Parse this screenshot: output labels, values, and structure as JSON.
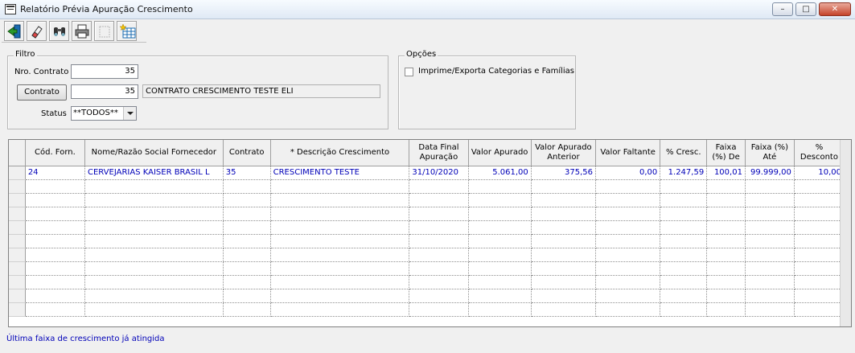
{
  "window": {
    "title": "Relatório Prévia Apuração Crescimento",
    "min_label": "–",
    "max_label": "□",
    "close_label": "✕"
  },
  "toolbar": {
    "icons": [
      "exit-icon",
      "eraser-icon",
      "binoculars-icon",
      "printer-icon",
      "disabled-preview-icon",
      "export-grid-icon"
    ]
  },
  "filter": {
    "legend": "Filtro",
    "nro_contrato_label": "Nro. Contrato",
    "nro_contrato_value": "35",
    "contrato_button": "Contrato",
    "contrato_value": "35",
    "contrato_desc": "CONTRATO CRESCIMENTO TESTE ELI",
    "status_label": "Status",
    "status_value": "**TODOS**"
  },
  "options": {
    "legend": "Opções",
    "checkbox_label": "Imprime/Exporta Categorias e Famílias",
    "checked": false
  },
  "grid": {
    "columns": [
      "Cód. Forn.",
      "Nome/Razão Social Fornecedor",
      "Contrato",
      "* Descrição Crescimento",
      "Data Final Apuração",
      "Valor Apurado",
      "Valor Apurado Anterior",
      "Valor Faltante",
      "% Cresc.",
      "Faixa (%) De",
      "Faixa (%) Até",
      "% Desconto"
    ],
    "rows": [
      [
        "24",
        "CERVEJARIAS KAISER BRASIL L",
        "35",
        "CRESCIMENTO TESTE",
        "31/10/2020",
        "5.061,00",
        "375,56",
        "0,00",
        "1.247,59",
        "100,01",
        "99.999,00",
        "10,00"
      ]
    ],
    "empty_rows": 10
  },
  "footer": {
    "message": "Última faixa de crescimento já atingida"
  },
  "colors": {
    "data_text": "#0000b8",
    "window_bg": "#f0f0f0"
  }
}
